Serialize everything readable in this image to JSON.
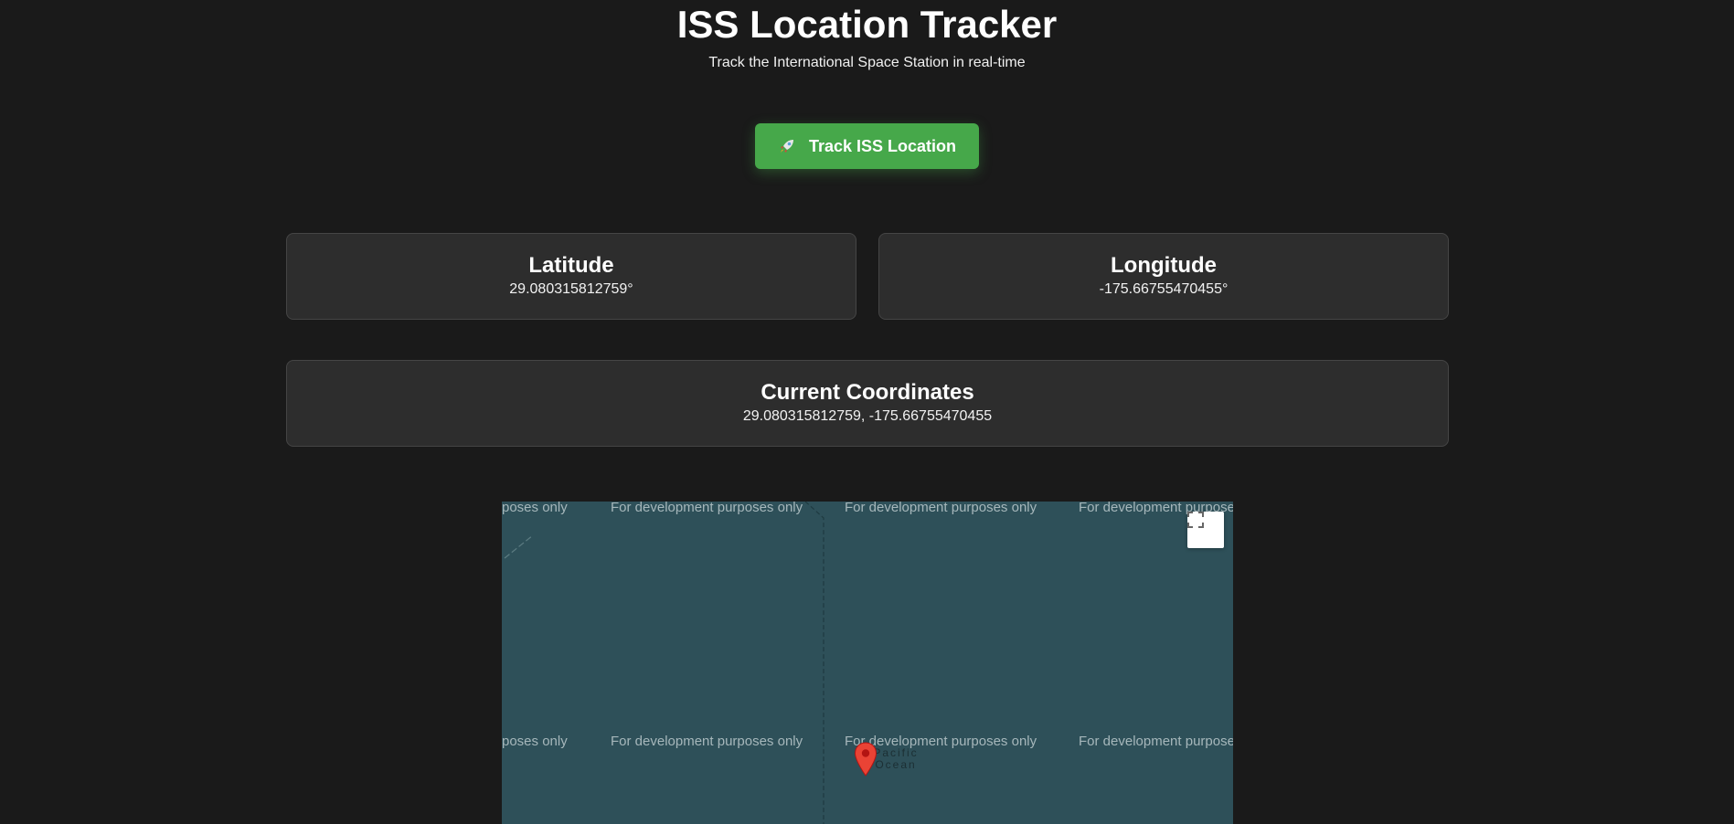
{
  "header": {
    "title": "ISS Location Tracker",
    "subtitle": "Track the International Space Station in real-time"
  },
  "actions": {
    "track_label": "Track ISS Location",
    "track_icon": "rocket-icon"
  },
  "cards": {
    "latitude": {
      "label": "Latitude",
      "value": "29.080315812759°"
    },
    "longitude": {
      "label": "Longitude",
      "value": "-175.66755470455°"
    },
    "coordinates": {
      "label": "Current Coordinates",
      "value": "29.080315812759, -175.66755470455"
    }
  },
  "map": {
    "watermark_text": "For development purposes only",
    "watermark_partial_left": "poses only",
    "watermark_partial_right": "For development purpose",
    "ocean_label": "Pacific Ocean",
    "ocean_label_partial": "Pacific\nOcean",
    "fullscreen_icon": "fullscreen-icon",
    "marker_icon": "map-pin-icon",
    "marker_color": "#ea4335",
    "background_color": "#2e5059"
  },
  "colors": {
    "page_background": "#1a1a1a",
    "card_background": "#2d2d2d",
    "button_green": "#46a84a"
  }
}
